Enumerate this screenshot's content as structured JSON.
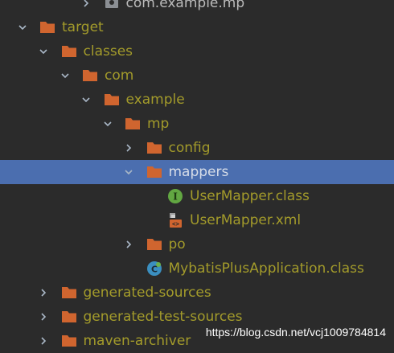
{
  "project_tree": {
    "items": [
      {
        "label": "com.example.mp",
        "depth": 4,
        "expanded": false,
        "icon": "package-icon",
        "style": "plain"
      },
      {
        "label": "target",
        "depth": 1,
        "expanded": true,
        "icon": "folder-icon"
      },
      {
        "label": "classes",
        "depth": 2,
        "expanded": true,
        "icon": "folder-icon"
      },
      {
        "label": "com",
        "depth": 3,
        "expanded": true,
        "icon": "folder-icon"
      },
      {
        "label": "example",
        "depth": 4,
        "expanded": true,
        "icon": "folder-icon"
      },
      {
        "label": "mp",
        "depth": 5,
        "expanded": true,
        "icon": "folder-icon"
      },
      {
        "label": "config",
        "depth": 6,
        "expanded": false,
        "icon": "folder-icon"
      },
      {
        "label": "mappers",
        "depth": 6,
        "expanded": true,
        "icon": "folder-icon",
        "selected": true
      },
      {
        "label": "UserMapper.class",
        "depth": 7,
        "icon": "interface-class-icon"
      },
      {
        "label": "UserMapper.xml",
        "depth": 7,
        "icon": "xml-file-icon"
      },
      {
        "label": "po",
        "depth": 6,
        "expanded": false,
        "icon": "folder-icon"
      },
      {
        "label": "MybatisPlusApplication.class",
        "depth": 6,
        "icon": "spring-boot-class-icon"
      },
      {
        "label": "generated-sources",
        "depth": 2,
        "expanded": false,
        "icon": "folder-icon"
      },
      {
        "label": "generated-test-sources",
        "depth": 2,
        "expanded": false,
        "icon": "folder-icon"
      },
      {
        "label": "maven-archiver",
        "depth": 2,
        "expanded": false,
        "icon": "folder-icon"
      }
    ]
  },
  "watermark": {
    "text": "https://blog.csdn.net/vcj1009784814"
  },
  "colors": {
    "background": "#2b2b2b",
    "selection": "#4b6eaf",
    "excluded_text": "#a39b2b",
    "folder_orange": "#d0652f",
    "arrow": "#a9b7c6"
  }
}
